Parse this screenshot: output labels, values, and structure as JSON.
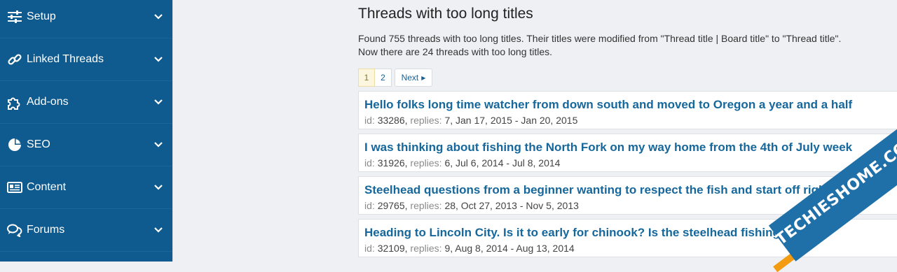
{
  "sidebar": {
    "items": [
      {
        "label": "Setup",
        "icon": "sliders-icon"
      },
      {
        "label": "Linked Threads",
        "icon": "link-icon"
      },
      {
        "label": "Add-ons",
        "icon": "puzzle-icon"
      },
      {
        "label": "SEO",
        "icon": "pie-chart-icon"
      },
      {
        "label": "Content",
        "icon": "newspaper-icon"
      },
      {
        "label": "Forums",
        "icon": "comments-icon"
      }
    ]
  },
  "main": {
    "title": "Threads with too long titles",
    "desc_line1": "Found 755 threads with too long titles. Their titles were modified from \"Thread title | Board title\" to \"Thread title\".",
    "desc_line2": "Now there are 24 threads with too long titles.",
    "pagination": {
      "current": "1",
      "page2": "2",
      "next": "Next"
    },
    "meta_labels": {
      "id": "id:",
      "replies": "replies:"
    },
    "threads": [
      {
        "title": "Hello folks long time watcher from down south and moved to Oregon a year and a half",
        "id": "33286,",
        "replies": "7, Jan 17, 2015 - Jan 20, 2015"
      },
      {
        "title": "I was thinking about fishing the North Fork on my way home from the 4th of July week",
        "id": "31926,",
        "replies": "6, Jul 6, 2014 - Jul 8, 2014"
      },
      {
        "title": "Steelhead questions from a beginner wanting to respect the fish and start off right",
        "id": "29765,",
        "replies": "28, Oct 27, 2013 - Nov 5, 2013"
      },
      {
        "title": "Heading to Lincoln City. Is it to early for chinook? Is the steelhead fishing still",
        "id": "32109,",
        "replies": "9, Aug 8, 2014 - Aug 13, 2014"
      }
    ]
  },
  "watermark": {
    "text": "TECHIESHOME.COM"
  },
  "colors": {
    "sidebar_bg": "#0f5a8e",
    "link": "#15679c",
    "page_bg": "#eef0f3"
  }
}
